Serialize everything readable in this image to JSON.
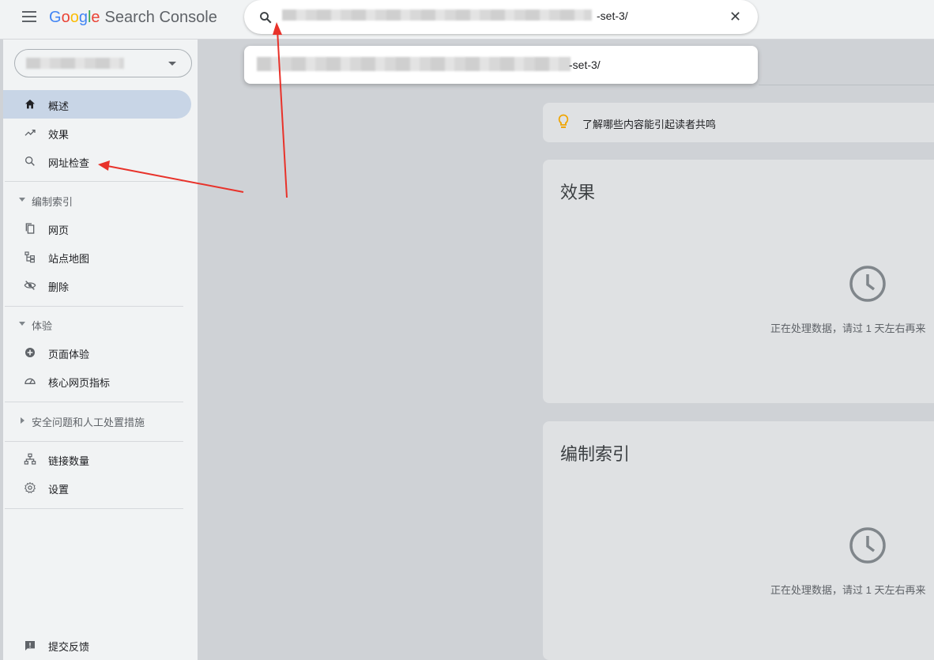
{
  "app": {
    "logo_letters": [
      "G",
      "o",
      "o",
      "g",
      "l",
      "e"
    ],
    "product_name": "Search Console"
  },
  "search": {
    "query_visible_suffix": "-set-3/",
    "suggestion_visible_suffix": "-set-3/",
    "clear_icon": "close-icon"
  },
  "sidebar": {
    "property_selector": "",
    "items": [
      {
        "label": "概述",
        "icon": "home-icon",
        "active": true
      },
      {
        "label": "效果",
        "icon": "trending-up-icon"
      },
      {
        "label": "网址检查",
        "icon": "search-icon"
      }
    ],
    "section_indexing": {
      "label": "编制索引",
      "items": [
        {
          "label": "网页",
          "icon": "pages-icon"
        },
        {
          "label": "站点地图",
          "icon": "sitemap-icon"
        },
        {
          "label": "删除",
          "icon": "visibility-off-icon"
        }
      ]
    },
    "section_experience": {
      "label": "体验",
      "items": [
        {
          "label": "页面体验",
          "icon": "add-circle-icon"
        },
        {
          "label": "核心网页指标",
          "icon": "speed-gauge-icon"
        }
      ]
    },
    "section_security": {
      "label": "安全问题和人工处置措施"
    },
    "bottom_items": [
      {
        "label": "链接数量",
        "icon": "links-tree-icon"
      },
      {
        "label": "设置",
        "icon": "gear-icon"
      }
    ],
    "feedback": {
      "label": "提交反馈",
      "icon": "feedback-icon"
    }
  },
  "main": {
    "tip": {
      "label": "了解哪些内容能引起读者共鸣",
      "icon": "lightbulb-icon"
    },
    "cards": [
      {
        "title": "效果",
        "message": "正在处理数据，请过 1 天左右再来"
      },
      {
        "title": "编制索引",
        "message": "正在处理数据，请过 1 天左右再来"
      }
    ]
  },
  "colors": {
    "accent_active": "#c8d5e6",
    "annotation_arrow": "#e8322a",
    "tip_icon": "#f0a500"
  }
}
